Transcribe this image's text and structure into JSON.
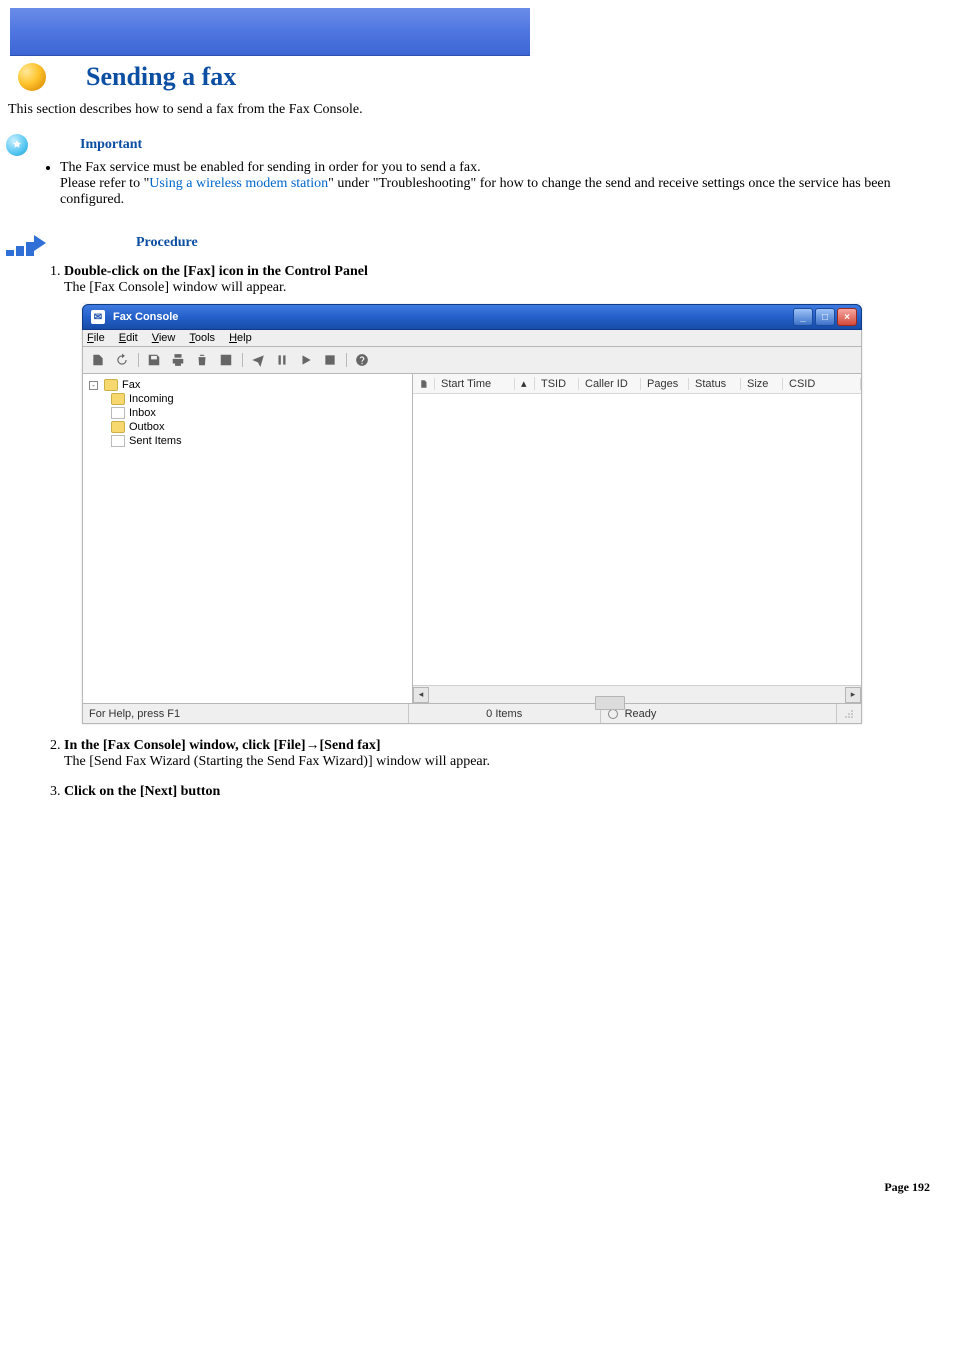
{
  "page_title": "Sending a fax",
  "intro_text": "This section describes how to send a fax from the Fax Console.",
  "important": {
    "heading": "Important",
    "bullet_pre": "The Fax service must be enabled for sending in order for you to send a fax.",
    "bullet_refer_prefix": "Please refer to \"",
    "bullet_link_text": "Using a wireless modem station",
    "bullet_refer_suffix": "\" under \"Troubleshooting\" for how to change the send and receive settings once the service has been configured."
  },
  "procedure": {
    "heading": "Procedure",
    "steps": [
      {
        "num": "1.",
        "head": "Double-click on the [Fax] icon in the Control Panel",
        "body": "The [Fax Console] window will appear."
      },
      {
        "num": "2.",
        "head": "In the [Fax Console] window, click [File]→[Send fax]",
        "body": "The [Send Fax Wizard (Starting the Send Fax Wizard)] window will appear."
      },
      {
        "num": "3.",
        "head": "Click on the [Next] button",
        "body": ""
      }
    ]
  },
  "fax_console": {
    "title": "Fax Console",
    "menu": {
      "file": "File",
      "edit": "Edit",
      "view": "View",
      "tools": "Tools",
      "help": "Help"
    },
    "tree": {
      "root": "Fax",
      "incoming": "Incoming",
      "inbox": "Inbox",
      "outbox": "Outbox",
      "sent": "Sent Items"
    },
    "columns": [
      "Start Time",
      "",
      "TSID",
      "Caller ID",
      "Pages",
      "Status",
      "Size",
      "CSID"
    ],
    "status": {
      "help": "For Help, press F1",
      "items": "0 Items",
      "ready": "Ready"
    }
  },
  "footer": "Page 192"
}
